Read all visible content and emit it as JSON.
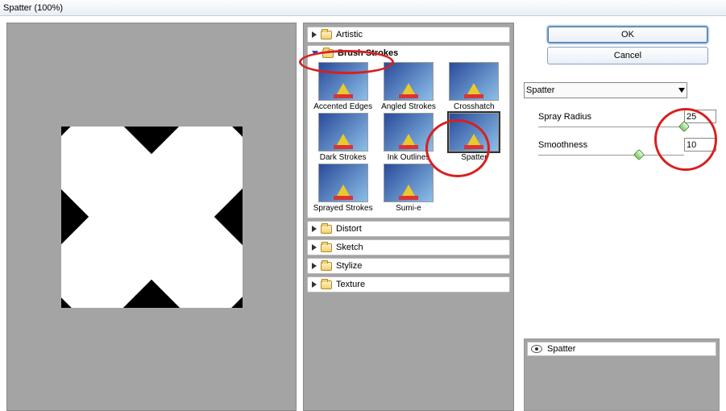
{
  "title": "Spatter (100%)",
  "buttons": {
    "ok": "OK",
    "cancel": "Cancel"
  },
  "filter_select": "Spatter",
  "params": {
    "spray_radius": {
      "label": "Spray Radius",
      "value": "25"
    },
    "smoothness": {
      "label": "Smoothness",
      "value": "10"
    }
  },
  "categories": [
    {
      "name": "Artistic",
      "open": false
    },
    {
      "name": "Brush Strokes",
      "open": true,
      "items": [
        "Accented Edges",
        "Angled Strokes",
        "Crosshatch",
        "Dark Strokes",
        "Ink Outlines",
        "Spatter",
        "Sprayed Strokes",
        "Sumi-e"
      ],
      "selected_index": 5
    },
    {
      "name": "Distort",
      "open": false
    },
    {
      "name": "Sketch",
      "open": false
    },
    {
      "name": "Stylize",
      "open": false
    },
    {
      "name": "Texture",
      "open": false
    }
  ],
  "stack": {
    "layer_label": "Spatter"
  }
}
